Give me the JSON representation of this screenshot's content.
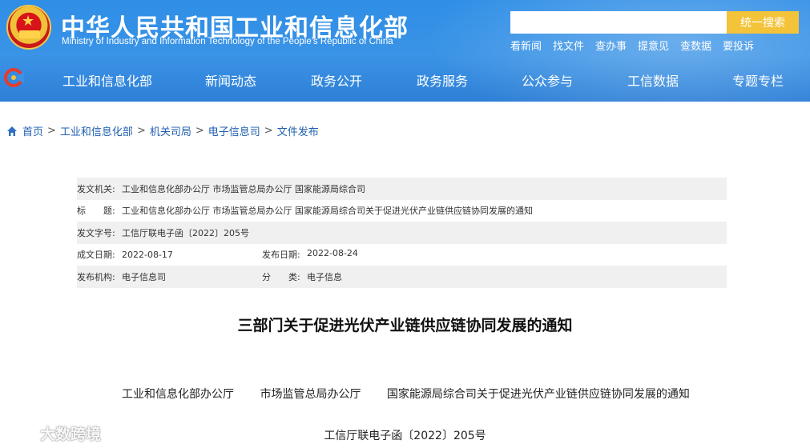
{
  "header": {
    "title": "中华人民共和国工业和信息化部",
    "subtitle": "Ministry of Industry and Information Technology of the People's Republic of China",
    "search_placeholder": "",
    "search_button": "统一搜索",
    "quicklinks": [
      "看新闻",
      "找文件",
      "查办事",
      "提意见",
      "查数据",
      "要投诉"
    ]
  },
  "nav": [
    "工业和信息化部",
    "新闻动态",
    "政务公开",
    "政务服务",
    "公众参与",
    "工信数据",
    "专题专栏"
  ],
  "breadcrumb": [
    "首页",
    "工业和信息化部",
    "机关司局",
    "电子信息司",
    "文件发布"
  ],
  "meta": {
    "issuer_label": "发文机关:",
    "issuer": "工业和信息化部办公厅 市场监管总局办公厅 国家能源局综合司",
    "title_label": "标　　题:",
    "title": "工业和信息化部办公厅 市场监管总局办公厅 国家能源局综合司关于促进光伏产业链供应链协同发展的通知",
    "doc_no_label": "发文字号:",
    "doc_no": "工信厅联电子函〔2022〕205号",
    "created_label": "成文日期:",
    "created": "2022-08-17",
    "published_label": "发布日期:",
    "published": "2022-08-24",
    "org_label": "发布机构:",
    "org": "电子信息司",
    "category_label": "分　　类:",
    "category": "电子信息"
  },
  "document": {
    "heading": "三部门关于促进光伏产业链供应链协同发展的通知",
    "line_parts": [
      "工业和信息化部办公厅",
      "市场监管总局办公厅",
      "国家能源局综合司关于促进光伏产业链供应链协同发展的通知"
    ],
    "number": "工信厅联电子函〔2022〕205号"
  },
  "watermark": "大数跨境"
}
